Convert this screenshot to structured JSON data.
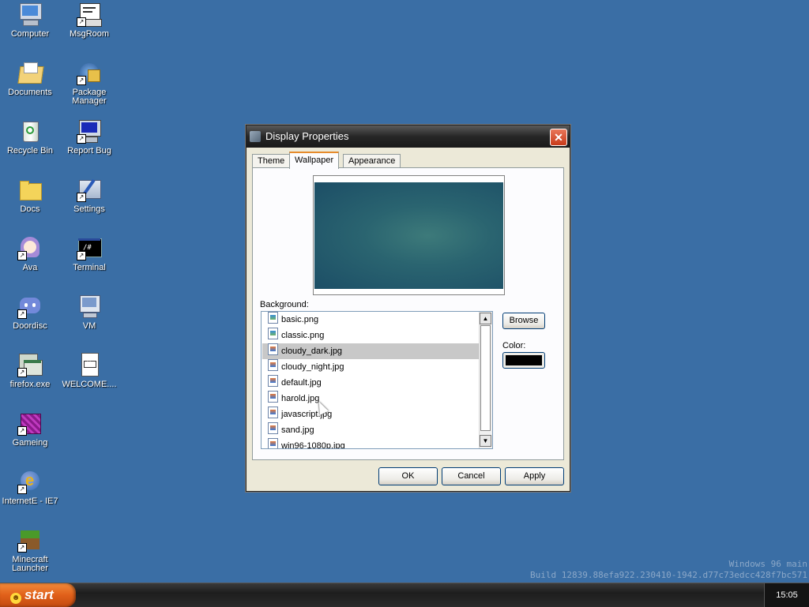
{
  "desktop": {
    "icons": [
      {
        "label": "Computer",
        "icon": "computer-icon"
      },
      {
        "label": "MsgRoom",
        "icon": "msgroom-icon"
      },
      {
        "label": "Documents",
        "icon": "documents-folder-icon"
      },
      {
        "label": "Package Manager",
        "icon": "package-manager-icon"
      },
      {
        "label": "Recycle Bin",
        "icon": "recycle-bin-icon"
      },
      {
        "label": "Report Bug",
        "icon": "report-bug-icon"
      },
      {
        "label": "Docs",
        "icon": "docs-folder-icon"
      },
      {
        "label": "Settings",
        "icon": "settings-icon"
      },
      {
        "label": "Ava",
        "icon": "ava-icon"
      },
      {
        "label": "Terminal",
        "icon": "terminal-icon"
      },
      {
        "label": "Doordisc",
        "icon": "doordisc-icon"
      },
      {
        "label": "VM",
        "icon": "vm-icon"
      },
      {
        "label": "firefox.exe",
        "icon": "firefox-exe-icon"
      },
      {
        "label": "WELCOME....",
        "icon": "welcome-doc-icon"
      },
      {
        "label": "Gameing",
        "icon": "gameing-icon"
      },
      {
        "label": "InternetE - IE7",
        "icon": "ie7-icon"
      },
      {
        "label": "Minecraft Launcher",
        "icon": "minecraft-icon"
      }
    ]
  },
  "watermark": {
    "line1": "Windows 96 main",
    "line2": "Build 12839.88efa922.230410-1942.d77c73edcc428f7bc571"
  },
  "taskbar": {
    "start_label": "start",
    "clock": "15:05"
  },
  "dialog": {
    "title": "Display Properties",
    "close_label": "✕",
    "tabs": [
      {
        "label": "Theme"
      },
      {
        "label": "Wallpaper"
      },
      {
        "label": "Appearance"
      }
    ],
    "active_tab": "Wallpaper",
    "background_label": "Background:",
    "files": [
      {
        "name": "basic.png",
        "type": "png"
      },
      {
        "name": "classic.png",
        "type": "png"
      },
      {
        "name": "cloudy_dark.jpg",
        "type": "jpg"
      },
      {
        "name": "cloudy_night.jpg",
        "type": "jpg"
      },
      {
        "name": "default.jpg",
        "type": "jpg"
      },
      {
        "name": "harold.jpg",
        "type": "jpg"
      },
      {
        "name": "javascript.jpg",
        "type": "jpg"
      },
      {
        "name": "sand.jpg",
        "type": "jpg"
      },
      {
        "name": "win96-1080p.jpg",
        "type": "jpg"
      }
    ],
    "selected_file": "cloudy_dark.jpg",
    "browse_label": "Browse",
    "color_label": "Color:",
    "color_value": "#000000",
    "ok_label": "OK",
    "cancel_label": "Cancel",
    "apply_label": "Apply"
  },
  "colors": {
    "desktop_bg": "#3a6ea5",
    "selection": "#c8c8c8",
    "start_button": "#e0601a"
  }
}
